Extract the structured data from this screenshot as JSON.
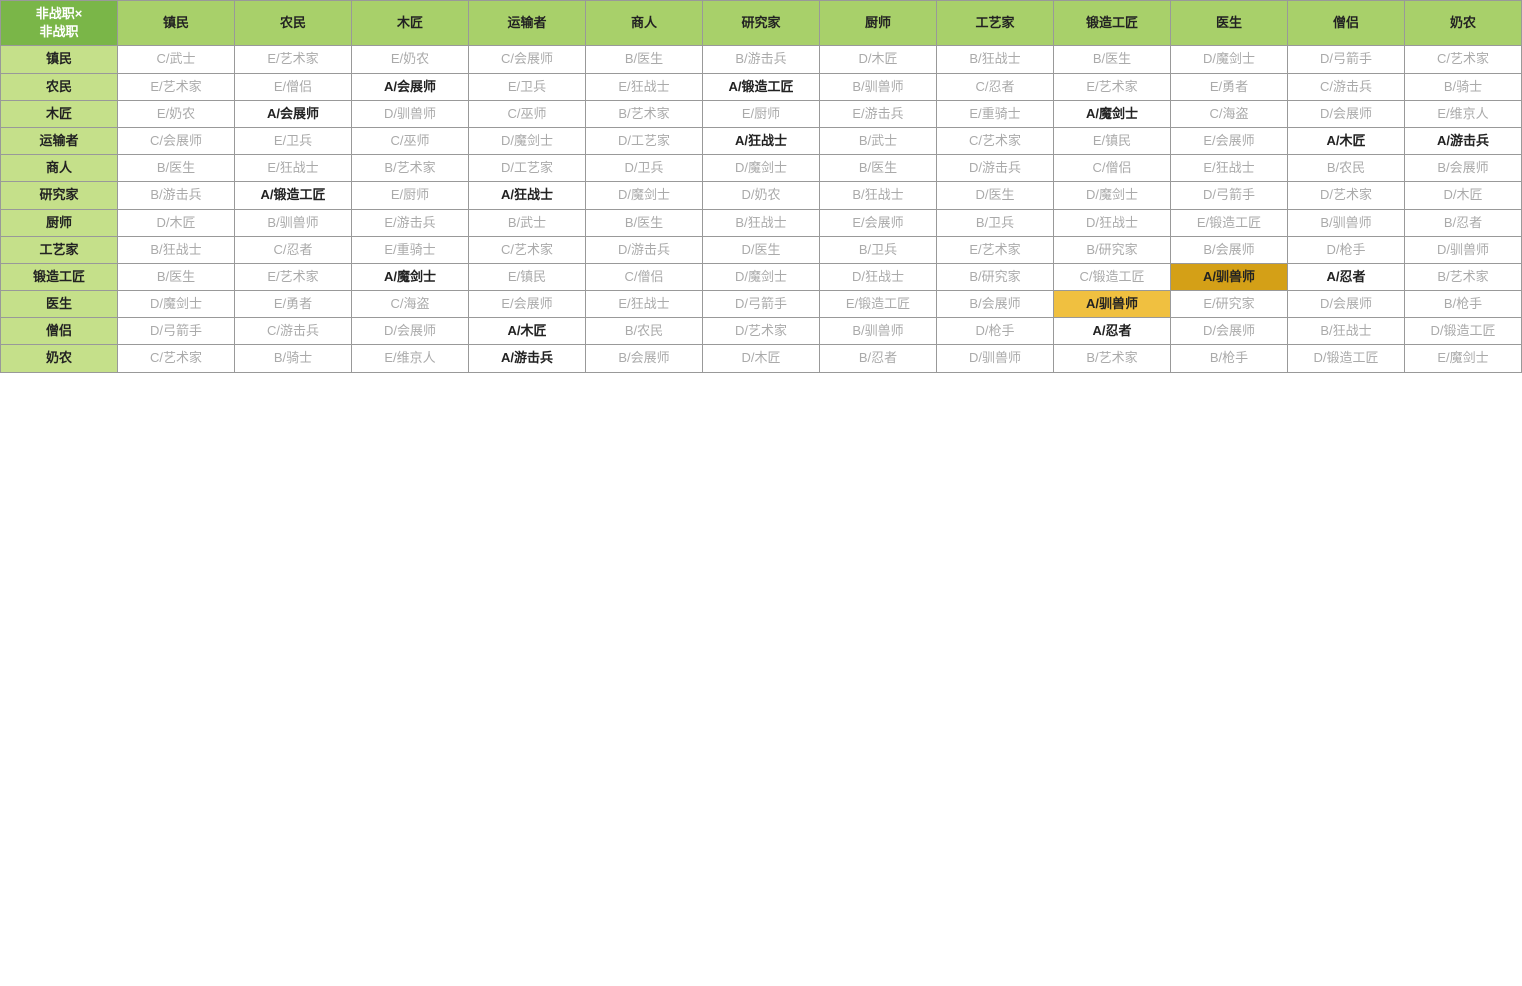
{
  "table": {
    "corner": "非战职×\n非战职",
    "col_headers": [
      "镇民",
      "农民",
      "木匠",
      "运输者",
      "商人",
      "研究家",
      "厨师",
      "工艺家",
      "锻造工匠",
      "医生",
      "僧侣",
      "奶农"
    ],
    "row_headers": [
      "镇民",
      "农民",
      "木匠",
      "运输者",
      "商人",
      "研究家",
      "厨师",
      "工艺家",
      "锻造工匠",
      "医生",
      "僧侣",
      "奶农"
    ],
    "rows": [
      [
        "C/武士",
        "E/艺术家",
        "E/奶农",
        "C/会展师",
        "B/医生",
        "B/游击兵",
        "D/木匠",
        "B/狂战士",
        "B/医生",
        "D/魔剑士",
        "D/弓箭手",
        "C/艺术家"
      ],
      [
        "E/艺术家",
        "E/僧侣",
        "A/会展师",
        "E/卫兵",
        "E/狂战士",
        "A/锻造工匠",
        "B/驯兽师",
        "C/忍者",
        "E/艺术家",
        "E/勇者",
        "C/游击兵",
        "B/骑士"
      ],
      [
        "E/奶农",
        "A/会展师",
        "D/驯兽师",
        "C/巫师",
        "B/艺术家",
        "E/厨师",
        "E/游击兵",
        "E/重骑士",
        "A/魔剑士",
        "C/海盗",
        "D/会展师",
        "E/维京人"
      ],
      [
        "C/会展师",
        "E/卫兵",
        "C/巫师",
        "D/魔剑士",
        "D/工艺家",
        "A/狂战士",
        "B/武士",
        "C/艺术家",
        "E/镇民",
        "E/会展师",
        "A/木匠",
        "A/游击兵"
      ],
      [
        "B/医生",
        "E/狂战士",
        "B/艺术家",
        "D/工艺家",
        "D/卫兵",
        "D/魔剑士",
        "B/医生",
        "D/游击兵",
        "C/僧侣",
        "E/狂战士",
        "B/农民",
        "B/会展师"
      ],
      [
        "B/游击兵",
        "A/锻造工匠",
        "E/厨师",
        "A/狂战士",
        "D/魔剑士",
        "D/奶农",
        "B/狂战士",
        "D/医生",
        "D/魔剑士",
        "D/弓箭手",
        "D/艺术家",
        "D/木匠"
      ],
      [
        "D/木匠",
        "B/驯兽师",
        "E/游击兵",
        "B/武士",
        "B/医生",
        "B/狂战士",
        "E/会展师",
        "B/卫兵",
        "D/狂战士",
        "E/锻造工匠",
        "B/驯兽师",
        "B/忍者"
      ],
      [
        "B/狂战士",
        "C/忍者",
        "E/重骑士",
        "C/艺术家",
        "D/游击兵",
        "D/医生",
        "B/卫兵",
        "E/艺术家",
        "B/研究家",
        "B/会展师",
        "D/枪手",
        "D/驯兽师"
      ],
      [
        "B/医生",
        "E/艺术家",
        "A/魔剑士",
        "E/镇民",
        "C/僧侣",
        "D/魔剑士",
        "D/狂战士",
        "B/研究家",
        "C/锻造工匠",
        "A/驯兽师",
        "A/忍者",
        "B/艺术家"
      ],
      [
        "D/魔剑士",
        "E/勇者",
        "C/海盗",
        "E/会展师",
        "E/狂战士",
        "D/弓箭手",
        "E/锻造工匠",
        "B/会展师",
        "A/驯兽师",
        "E/研究家",
        "D/会展师",
        "B/枪手"
      ],
      [
        "D/弓箭手",
        "C/游击兵",
        "D/会展师",
        "A/木匠",
        "B/农民",
        "D/艺术家",
        "B/驯兽师",
        "D/枪手",
        "A/忍者",
        "D/会展师",
        "B/狂战士",
        "D/锻造工匠"
      ],
      [
        "C/艺术家",
        "B/骑士",
        "E/维京人",
        "A/游击兵",
        "B/会展师",
        "D/木匠",
        "B/忍者",
        "D/驯兽师",
        "B/艺术家",
        "B/枪手",
        "D/锻造工匠",
        "E/魔剑士"
      ]
    ],
    "bold_cells": [
      [
        0,
        2,
        false
      ],
      [
        0,
        4,
        false
      ],
      [
        0,
        5,
        false
      ],
      [
        0,
        7,
        false
      ],
      [
        0,
        8,
        false
      ],
      [
        1,
        2,
        true
      ],
      [
        1,
        5,
        true
      ],
      [
        2,
        1,
        true
      ],
      [
        2,
        8,
        true
      ],
      [
        3,
        5,
        true
      ],
      [
        3,
        10,
        true
      ],
      [
        3,
        11,
        true
      ],
      [
        4,
        0,
        false
      ],
      [
        5,
        1,
        true
      ],
      [
        5,
        3,
        true
      ],
      [
        6,
        0,
        false
      ],
      [
        7,
        8,
        false
      ],
      [
        7,
        9,
        false
      ],
      [
        8,
        2,
        true
      ],
      [
        8,
        9,
        "gold"
      ],
      [
        8,
        10,
        true
      ],
      [
        9,
        8,
        "yellow"
      ],
      [
        10,
        3,
        true
      ],
      [
        10,
        8,
        true
      ],
      [
        11,
        3,
        true
      ]
    ],
    "highlight_cells": {
      "gold": [
        [
          8,
          9
        ]
      ],
      "yellow": [
        [
          9,
          8
        ]
      ]
    }
  }
}
